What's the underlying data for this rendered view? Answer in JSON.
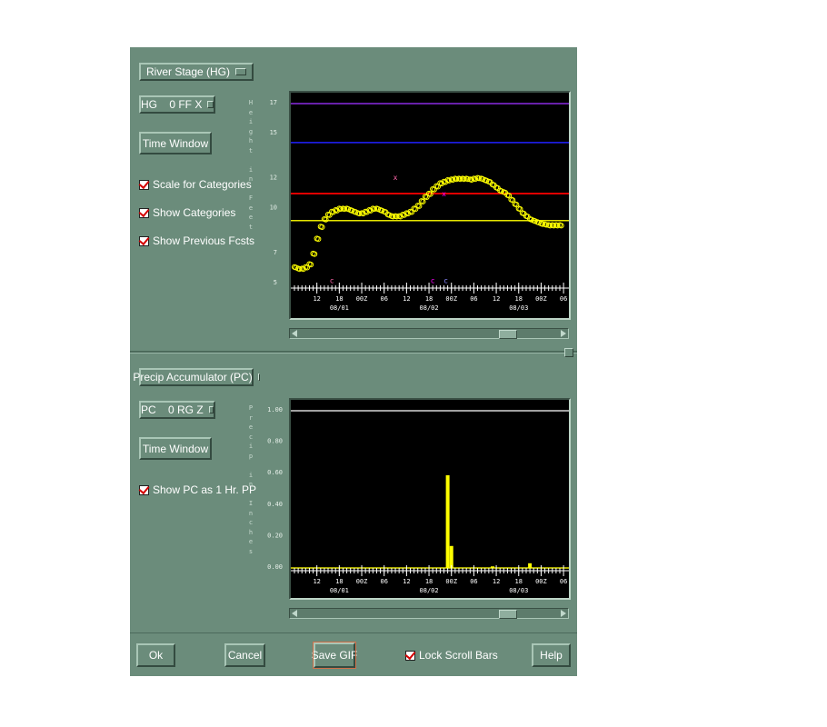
{
  "top_panel": {
    "product_menu": "River Stage (HG)",
    "type_menu": "HG    0 FF X",
    "time_window_label": "Time Window",
    "checkboxes": [
      {
        "label": "Scale for Categories",
        "checked": true
      },
      {
        "label": "Show Categories",
        "checked": true
      },
      {
        "label": "Show Previous Fcsts",
        "checked": true
      }
    ],
    "y_axis_label_chars": [
      "H",
      "e",
      "i",
      "g",
      "h",
      "t",
      "",
      "i",
      "n",
      "",
      "F",
      "e",
      "e",
      "t"
    ],
    "y_ticks": [
      "17",
      "15",
      "12",
      "10",
      "7",
      "5"
    ],
    "x_ticks": [
      "12",
      "18",
      "00Z",
      "06",
      "12",
      "18",
      "00Z",
      "06",
      "12",
      "18",
      "00Z",
      "06"
    ],
    "date_labels": [
      "08/01",
      "08/02",
      "08/03"
    ],
    "markers": [
      "x",
      "x",
      "c",
      "c",
      "c"
    ]
  },
  "bottom_panel": {
    "product_menu": "Precip Accumulator (PC)",
    "type_menu": "PC    0 RG Z",
    "time_window_label": "Time Window",
    "checkboxes": [
      {
        "label": "Show PC as 1 Hr. PP",
        "checked": true
      }
    ],
    "y_axis_label_chars": [
      "P",
      "r",
      "e",
      "c",
      "i",
      "p",
      "",
      "i",
      "n",
      "",
      "I",
      "n",
      "c",
      "h",
      "e",
      "s"
    ],
    "y_ticks": [
      "1.00",
      "0.80",
      "0.60",
      "0.40",
      "0.20",
      "0.00"
    ],
    "x_ticks": [
      "12",
      "18",
      "00Z",
      "06",
      "12",
      "18",
      "00Z",
      "06",
      "12",
      "18",
      "00Z",
      "06"
    ],
    "date_labels": [
      "08/01",
      "08/02",
      "08/03"
    ]
  },
  "footer": {
    "ok_label": "Ok",
    "cancel_label": "Cancel",
    "save_gif_label": "Save GIF",
    "lock_scroll_label": "Lock Scroll Bars",
    "lock_scroll_checked": true,
    "help_label": "Help"
  },
  "colors": {
    "panel_bg": "#6b8c7b",
    "chart_bg": "#000000",
    "stage_series": "#ffff00",
    "category_purple": "#8a2be2",
    "category_blue": "#2020ff",
    "category_red": "#e00000",
    "category_yellow": "#e6e600",
    "precip_bars": "#ffff00"
  },
  "chart_data": [
    {
      "type": "scatter",
      "title": "",
      "ylabel": "Height in Feet",
      "ylim": [
        5,
        17
      ],
      "y_ticks": [
        5,
        7,
        10,
        12,
        15,
        17
      ],
      "threshold_lines": [
        17,
        14.4,
        11,
        9.2
      ],
      "series": [
        {
          "x_hours": [
            0,
            1,
            2,
            3,
            4,
            5,
            6,
            7,
            8,
            9,
            10,
            11,
            12,
            13,
            14,
            15,
            16,
            17,
            18,
            19,
            20,
            21,
            22,
            23,
            24,
            25,
            26,
            27,
            28,
            29,
            30,
            31,
            32,
            33,
            34,
            35,
            36,
            37,
            38,
            39,
            40,
            41,
            42,
            43,
            44,
            45,
            46,
            47,
            48,
            49,
            50,
            51,
            52,
            53,
            54,
            55,
            56,
            57,
            58,
            59,
            60,
            61,
            62,
            63,
            64,
            65,
            66,
            67,
            68,
            69,
            70,
            71
          ],
          "values": [
            6.1,
            6.0,
            6.0,
            6.1,
            6.3,
            7.0,
            8.0,
            8.8,
            9.3,
            9.6,
            9.8,
            9.9,
            10.0,
            10.0,
            10.0,
            9.9,
            9.8,
            9.7,
            9.7,
            9.8,
            9.9,
            10.0,
            10.0,
            9.9,
            9.8,
            9.6,
            9.5,
            9.5,
            9.5,
            9.6,
            9.7,
            9.8,
            10.0,
            10.2,
            10.5,
            10.8,
            11.0,
            11.3,
            11.5,
            11.7,
            11.8,
            11.9,
            11.95,
            12.0,
            12.0,
            12.0,
            12.0,
            11.95,
            12.0,
            12.05,
            12.0,
            11.9,
            11.8,
            11.6,
            11.4,
            11.2,
            11.1,
            10.9,
            10.6,
            10.3,
            10.0,
            9.7,
            9.5,
            9.3,
            9.2,
            9.1,
            9.0,
            8.95,
            8.9,
            8.9,
            8.9,
            8.9
          ]
        }
      ]
    },
    {
      "type": "bar",
      "title": "",
      "ylabel": "Precip in Inches",
      "ylim": [
        0,
        1.0
      ],
      "y_ticks": [
        0.0,
        0.2,
        0.4,
        0.6,
        0.8,
        1.0
      ],
      "reference_line": 1.0,
      "series": [
        {
          "x_hours": [
            41,
            42,
            53,
            63
          ],
          "values": [
            0.59,
            0.14,
            0.01,
            0.03
          ]
        }
      ]
    }
  ]
}
